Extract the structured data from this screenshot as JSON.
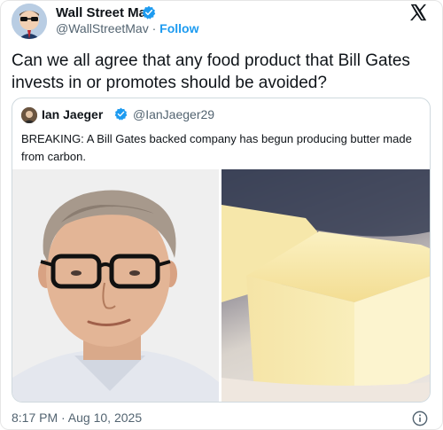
{
  "tweet": {
    "author_name": "Wall Street Mav",
    "author_handle": "@WallStreetMav",
    "separator": " · ",
    "follow_label": "Follow",
    "text": "Can we all agree that any food product that Bill Gates invests in or promotes should be avoided?",
    "timestamp": "8:17 PM · Aug 10, 2025"
  },
  "quoted_tweet": {
    "author_name": "Ian Jaeger",
    "author_handle": "@IanJaeger29",
    "text": "BREAKING: A Bill Gates backed company has begun producing butter made from carbon."
  },
  "icons": {
    "platform_logo": "x-logo-icon",
    "verified": "verified-badge-icon",
    "info": "info-icon"
  },
  "colors": {
    "accent": "#1d9bf0",
    "secondary_text": "#536471",
    "primary_text": "#0f1419",
    "border": "#cfd9de"
  }
}
